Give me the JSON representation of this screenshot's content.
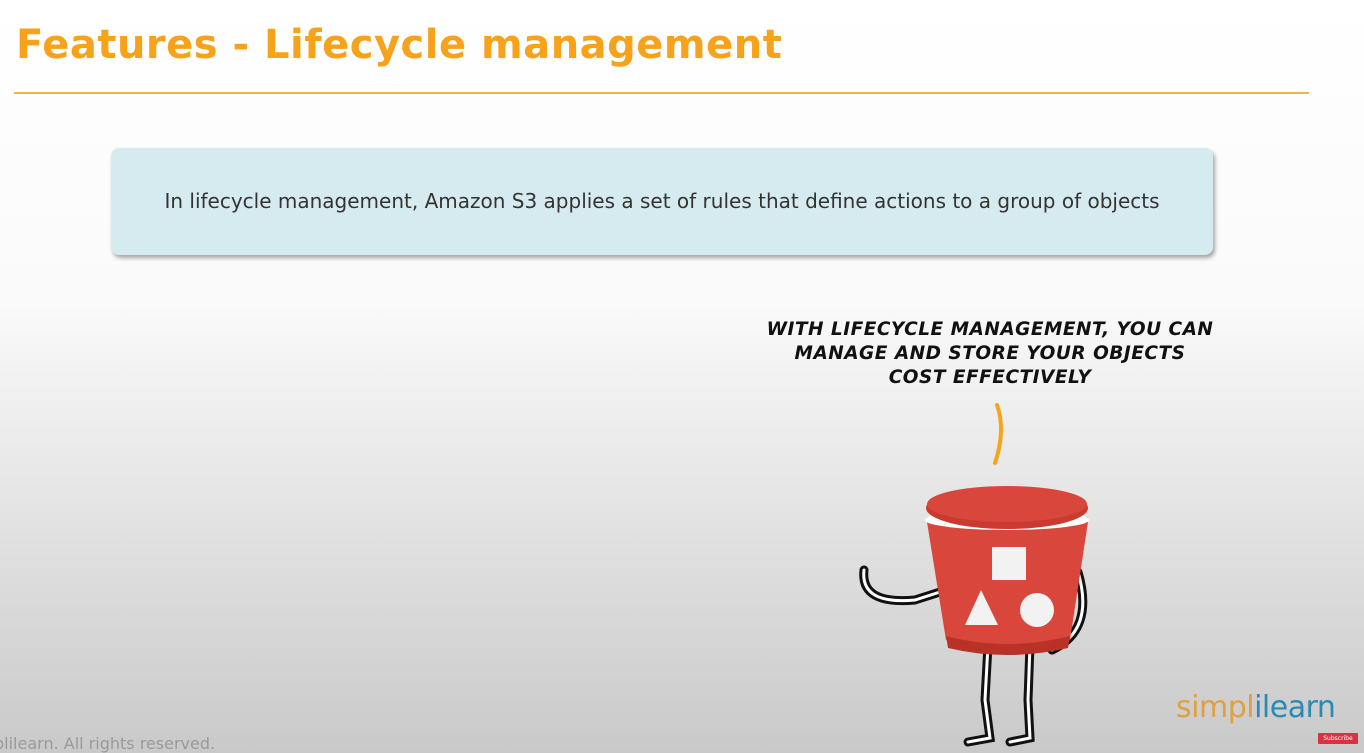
{
  "slide": {
    "title": "Features - Lifecycle management",
    "definition": "In lifecycle management, Amazon S3 applies a set of rules that define actions to a group of objects",
    "speech_bubble": "With lifecycle management, you can manage and store your objects cost effectively",
    "mascot_icon": "s3-bucket-character-icon",
    "footer": "plilearn. All rights reserved."
  },
  "branding": {
    "logo_part1": "simpl",
    "logo_part2": "ilearn",
    "subscribe_label": "Subscribe"
  },
  "colors": {
    "title": "#f7a21b",
    "box": "#d6ebef",
    "bucket": "#d9463b"
  }
}
